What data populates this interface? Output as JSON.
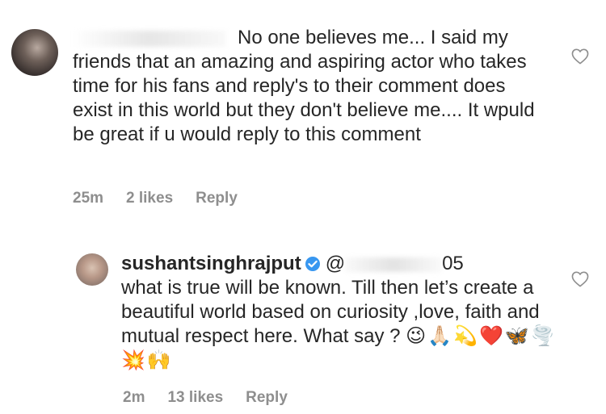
{
  "comment1": {
    "text": "No one believes me... I said my friends that an amazing and aspiring actor who takes time for his fans and reply's to their comment does exist in this world but they don't believe me.... It wpuld be great if u would reply to this comment",
    "time": "25m",
    "likes": "2 likes",
    "reply_label": "Reply"
  },
  "comment2": {
    "username": "sushantsinghrajput",
    "mention_prefix": "@",
    "mention_suffix": "05",
    "text": "what is true will be known. Till then let’s create a beautiful world based on curiosity ,love, faith and mutual respect here. What say ?",
    "emojis": "😉🙏🏻💫❤️🦋🌪️💥🙌",
    "time": "2m",
    "likes": "13 likes",
    "reply_label": "Reply"
  },
  "icons": {
    "like": "heart-outline-icon",
    "verified": "verified-badge-icon"
  },
  "colors": {
    "text": "#262626",
    "meta": "#8e8e8e",
    "verified": "#3897f0"
  }
}
